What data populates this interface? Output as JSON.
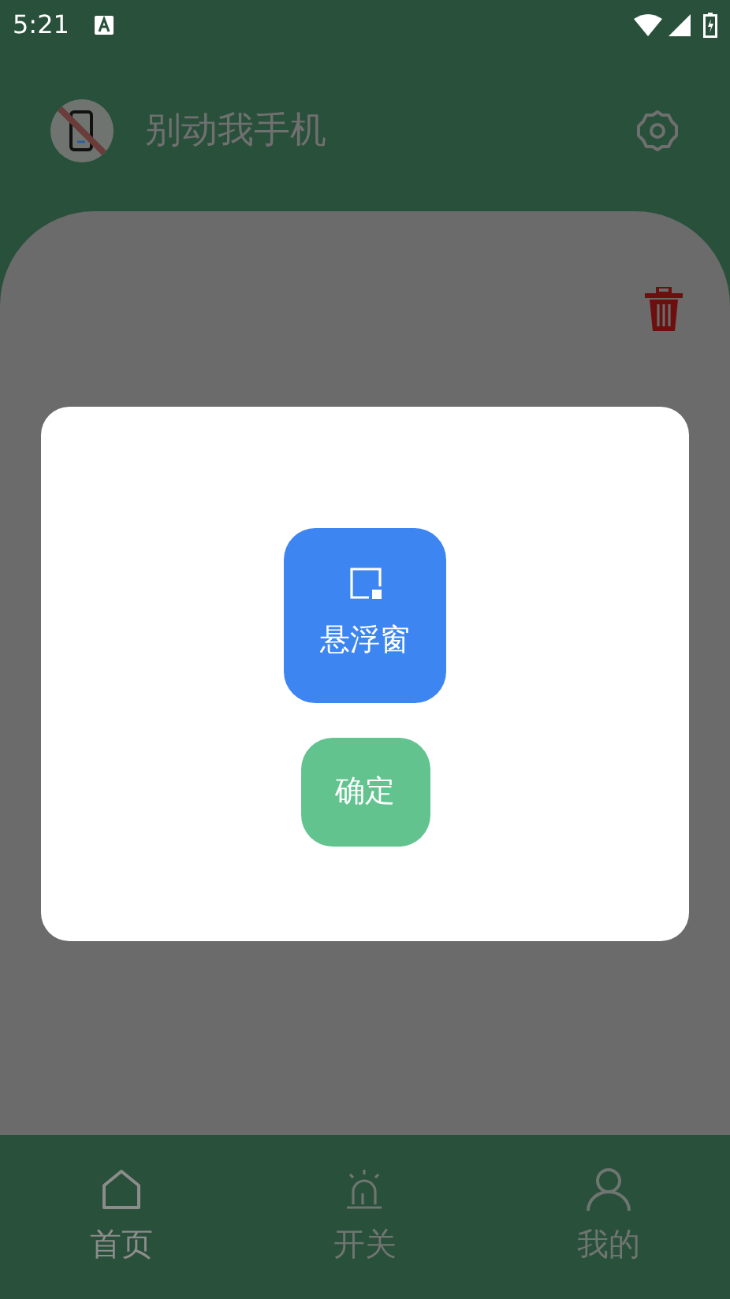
{
  "status_bar": {
    "time": "5:21"
  },
  "app_bar": {
    "title": "别动我手机"
  },
  "dialog": {
    "buttons": [
      {
        "kind": "tile",
        "label": "悬浮窗"
      },
      {
        "kind": "pill",
        "label": "确定"
      }
    ]
  },
  "bottom_nav": [
    {
      "label": "首页",
      "kind": "home",
      "selected": true
    },
    {
      "label": "开关",
      "kind": "alarm",
      "selected": false
    },
    {
      "label": "我的",
      "kind": "person",
      "selected": false
    }
  ]
}
